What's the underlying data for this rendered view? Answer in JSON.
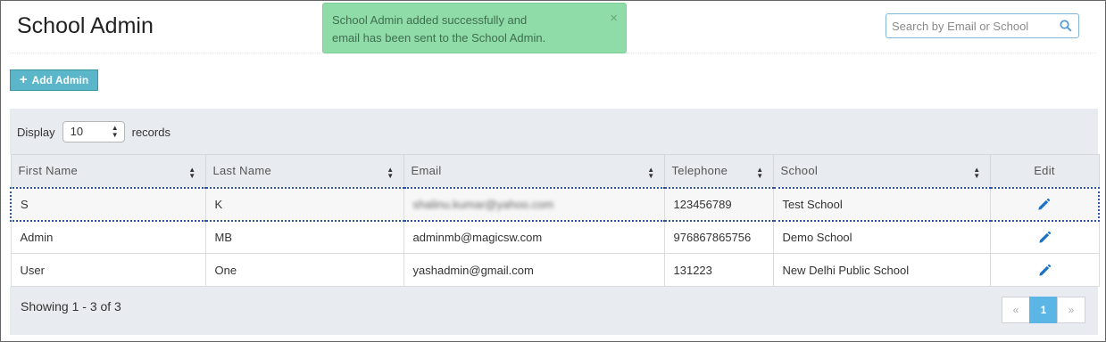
{
  "header": {
    "title": "School Admin",
    "search_placeholder": "Search by Email or School"
  },
  "toast": {
    "line1": "School Admin added successfully and",
    "line2": "email has been sent to the School Admin.",
    "close": "×"
  },
  "toolbar": {
    "add_label": "Add Admin"
  },
  "display": {
    "prefix": "Display",
    "value": "10",
    "suffix": "records"
  },
  "table": {
    "columns": [
      "First Name",
      "Last Name",
      "Email",
      "Telephone",
      "School",
      "Edit"
    ],
    "rows": [
      {
        "first": "S",
        "last": "K",
        "email": "shalinu.kumar@yahoo.com",
        "phone": "123456789",
        "school": "Test School"
      },
      {
        "first": "Admin",
        "last": "MB",
        "email": "adminmb@magicsw.com",
        "phone": "976867865756",
        "school": "Demo School"
      },
      {
        "first": "User",
        "last": "One",
        "email": "yashadmin@gmail.com",
        "phone": "131223",
        "school": "New Delhi Public School"
      }
    ]
  },
  "footer": {
    "showing": "Showing 1 - 3 of 3"
  },
  "pagination": {
    "prev": "«",
    "current": "1",
    "next": "»"
  },
  "colors": {
    "toast_bg": "#8fdca8",
    "accent_button": "#5bb6c9",
    "active_page": "#5bb6e6",
    "edit_icon": "#1a73c9"
  }
}
